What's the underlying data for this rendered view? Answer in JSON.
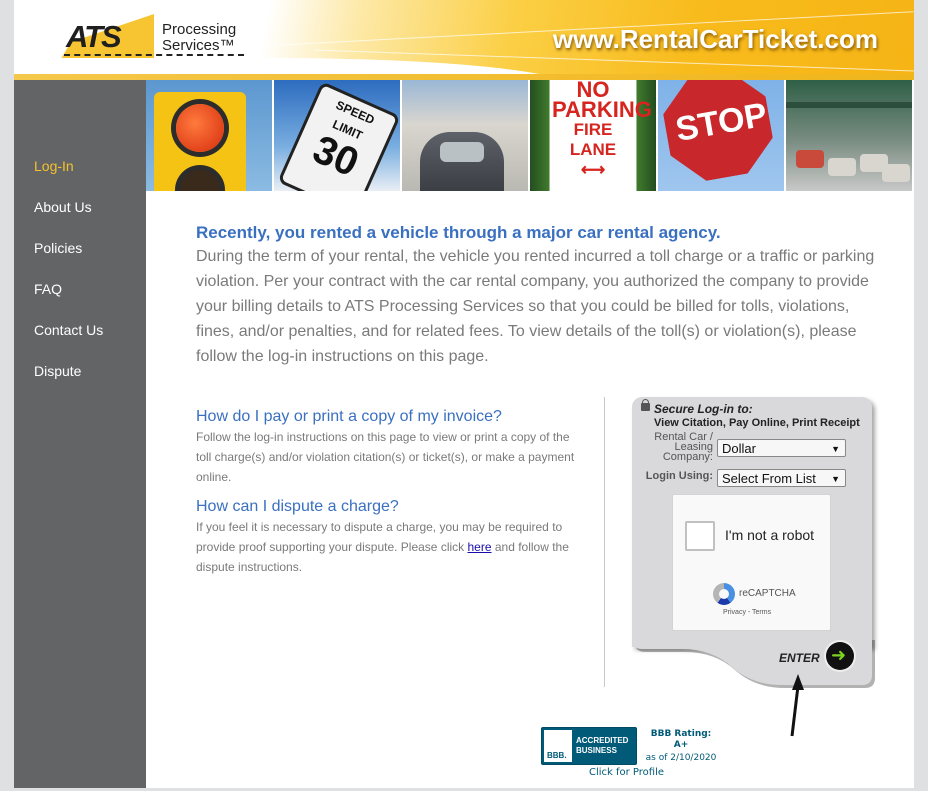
{
  "header": {
    "logo_main": "ATS",
    "logo_sub_line1": "Processing",
    "logo_sub_line2": "Services™",
    "site_url": "www.RentalCarTicket.com"
  },
  "sidebar": {
    "items": [
      {
        "label": "Log-In",
        "active": true
      },
      {
        "label": "About Us",
        "active": false
      },
      {
        "label": "Policies",
        "active": false
      },
      {
        "label": "FAQ",
        "active": false
      },
      {
        "label": "Contact Us",
        "active": false
      },
      {
        "label": "Dispute",
        "active": false
      }
    ]
  },
  "banner": {
    "images": [
      "traffic-light",
      "speed-limit-sign",
      "parking-meter",
      "no-parking-sign",
      "stop-sign",
      "toll-plaza"
    ],
    "speed_sign_line1": "SPEED",
    "speed_sign_line2": "LIMIT",
    "speed_sign_value": "30",
    "no_parking_line1": "NO",
    "no_parking_line2": "PARKING",
    "no_parking_line3": "FIRE",
    "no_parking_line4": "LANE",
    "stop_text": "STOP"
  },
  "intro": {
    "title": "Recently, you rented a vehicle through a major car rental agency.",
    "body": "During the term of your rental, the vehicle you rented incurred a toll charge or a traffic or parking violation. Per your contract with the car rental company, you authorized the company to provide your billing details to ATS Processing Services so that you could be billed for tolls, violations, fines, and/or penalties, and for related fees. To view details of the toll(s) or violation(s), please follow the log-in instructions on this page."
  },
  "faq": {
    "q1": "How do I pay or print a copy of my invoice?",
    "a1": "Follow the log-in instructions on this page to view or print a copy of the toll charge(s) and/or violation citation(s) or ticket(s), or make a payment online.",
    "q2": "How can I dispute a charge?",
    "a2_before": "If you feel it is necessary to dispute a charge, you may be required to provide proof supporting your dispute. Please click ",
    "a2_link": "here",
    "a2_after": " and follow the dispute instructions."
  },
  "login": {
    "title": "Secure Log-in to:",
    "subtitle": "View Citation, Pay Online, Print Receipt",
    "company_label_1": "Rental Car /",
    "company_label_2": "Leasing",
    "company_label_3": "Company:",
    "company_value": "Dollar",
    "login_using_label": "Login Using:",
    "login_using_value": "Select From List",
    "captcha_text": "I'm not a robot",
    "captcha_brand": "reCAPTCHA",
    "captcha_links": "Privacy - Terms",
    "enter_label": "ENTER"
  },
  "bbb": {
    "seal_text": "BBB.",
    "accredited_line1": "ACCREDITED",
    "accredited_line2": "BUSINESS",
    "rating_label": "BBB Rating:",
    "rating_value": "A+",
    "as_of": "as of 2/10/2020",
    "profile_link": "Click for Profile"
  },
  "colors": {
    "sidebar_bg": "#636466",
    "active_nav": "#f4c12e",
    "heading_blue": "#3a70c0",
    "body_gray": "#7a7a7a",
    "header_yellow": "#f8bb1c",
    "bbb_blue": "#005a78"
  }
}
